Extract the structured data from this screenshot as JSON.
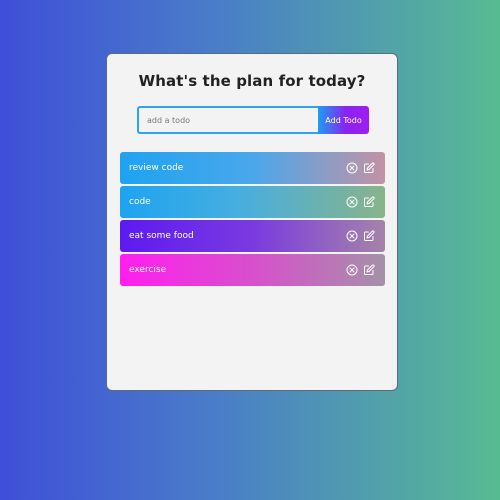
{
  "app": {
    "title": "What's the plan for today?"
  },
  "form": {
    "input_value": "",
    "input_placeholder": "add a todo",
    "add_button_label": "Add Todo"
  },
  "todos": [
    {
      "text": "review code",
      "delete_icon": "close-circle-icon",
      "edit_icon": "edit-icon"
    },
    {
      "text": "code",
      "delete_icon": "close-circle-icon",
      "edit_icon": "edit-icon"
    },
    {
      "text": "eat some food",
      "delete_icon": "close-circle-icon",
      "edit_icon": "edit-icon"
    },
    {
      "text": "exercise",
      "delete_icon": "close-circle-icon",
      "edit_icon": "edit-icon"
    }
  ],
  "colors": {
    "background_start": "#3f4fd8",
    "background_end": "#57bb92",
    "card": "#f3f3f3",
    "input_border": "#2fa3ef"
  }
}
